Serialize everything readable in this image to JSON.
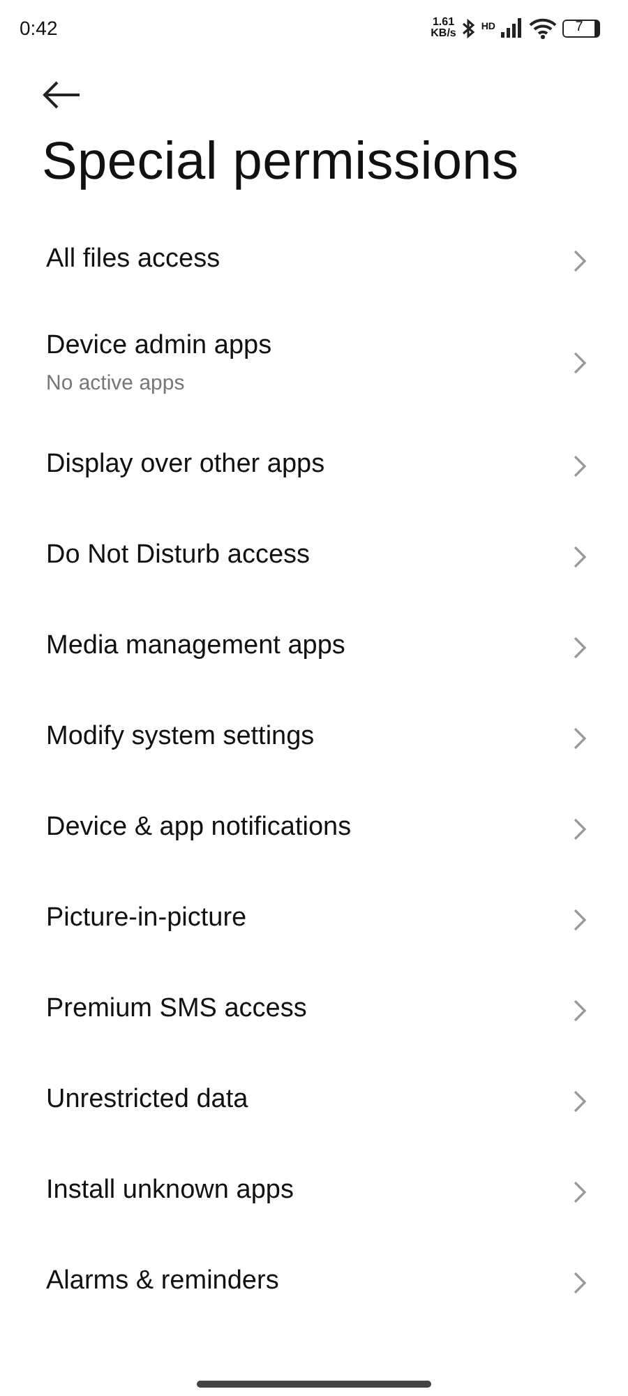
{
  "status_bar": {
    "time": "0:42",
    "speed": "1.61",
    "speed_unit": "KB/s",
    "network_label": "HD",
    "battery": "7"
  },
  "title": "Special permissions",
  "items": [
    {
      "label": "All files access"
    },
    {
      "label": "Device admin apps",
      "subtitle": "No active apps"
    },
    {
      "label": "Display over other apps"
    },
    {
      "label": "Do Not Disturb access"
    },
    {
      "label": "Media management apps"
    },
    {
      "label": "Modify system settings"
    },
    {
      "label": "Device & app notifications"
    },
    {
      "label": "Picture-in-picture"
    },
    {
      "label": "Premium SMS access"
    },
    {
      "label": "Unrestricted data"
    },
    {
      "label": "Install unknown apps"
    },
    {
      "label": "Alarms & reminders"
    }
  ]
}
